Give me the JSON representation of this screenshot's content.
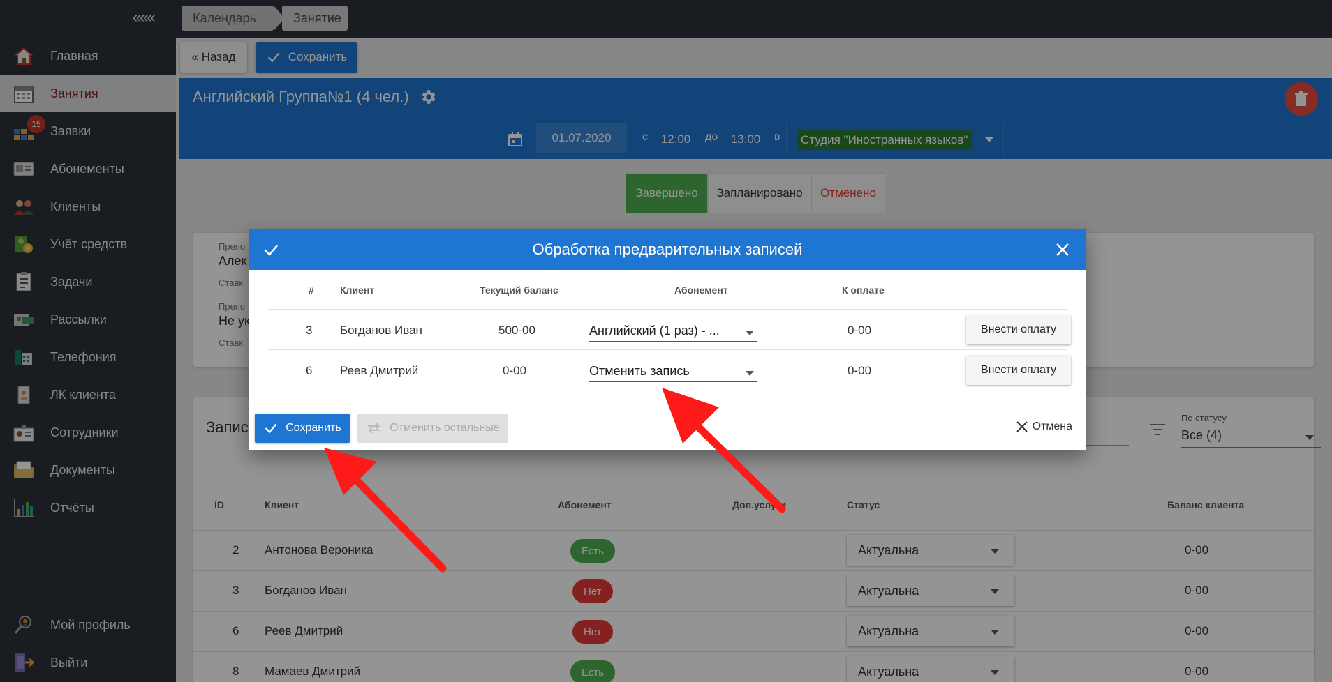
{
  "sidebar": {
    "collapse_label": "«««",
    "items": [
      {
        "label": "Главная",
        "icon": "home-icon"
      },
      {
        "label": "Занятия",
        "icon": "calendar-icon",
        "active": true
      },
      {
        "label": "Заявки",
        "icon": "requests-icon",
        "badge": "15"
      },
      {
        "label": "Абонементы",
        "icon": "subscription-card-icon"
      },
      {
        "label": "Клиенты",
        "icon": "clients-icon"
      },
      {
        "label": "Учёт средств",
        "icon": "money-icon"
      },
      {
        "label": "Задачи",
        "icon": "tasks-icon"
      },
      {
        "label": "Рассылки",
        "icon": "mailing-icon"
      },
      {
        "label": "Телефония",
        "icon": "phone-icon"
      },
      {
        "label": "ЛК клиента",
        "icon": "client-account-icon"
      },
      {
        "label": "Сотрудники",
        "icon": "staff-icon"
      },
      {
        "label": "Документы",
        "icon": "documents-icon"
      },
      {
        "label": "Отчёты",
        "icon": "reports-icon"
      },
      {
        "label": "Мой профиль",
        "icon": "profile-icon"
      },
      {
        "label": "Выйти",
        "icon": "logout-icon"
      }
    ]
  },
  "breadcrumbs": [
    "Календарь",
    "Занятие"
  ],
  "toolbar": {
    "back_label": "« Назад",
    "save_label": "Сохранить"
  },
  "lesson": {
    "title": "Английский Группа№1 (4 чел.)",
    "date": "01.07.2020",
    "from_label": "с",
    "from_time": "12:00",
    "to_label": "до",
    "to_time": "13:00",
    "in_label": "в",
    "room": "Студия \"Иностранных языков\""
  },
  "status_tabs": [
    "Завершено",
    "Запланировано",
    "Отменено"
  ],
  "teacher_card": {
    "label1": "Препо",
    "value1": "Алек",
    "sub1": "Ставк",
    "label2": "Препо",
    "value2": "Не ук",
    "sub2": "Ставк"
  },
  "records": {
    "title": "Запис",
    "status_filter_label": "По статусу",
    "status_filter_value": "Все (4)",
    "columns": [
      "ID",
      "Клиент",
      "Абонемент",
      "Доп.услуги",
      "Статус",
      "Баланс клиента"
    ],
    "rows": [
      {
        "id": "2",
        "client": "Антонова Вероника",
        "subscription": "Есть",
        "has_sub": true,
        "status": "Актуальна",
        "balance": "0-00"
      },
      {
        "id": "3",
        "client": "Богданов Иван",
        "subscription": "Нет",
        "has_sub": false,
        "status": "Актуальна",
        "balance": "0-00"
      },
      {
        "id": "6",
        "client": "Реев Дмитрий",
        "subscription": "Нет",
        "has_sub": false,
        "status": "Актуальна",
        "balance": "0-00"
      },
      {
        "id": "8",
        "client": "Мамаев Дмитрий",
        "subscription": "Есть",
        "has_sub": true,
        "status": "Актуальна",
        "balance": "0-00"
      }
    ]
  },
  "modal": {
    "title": "Обработка предварительных записей",
    "columns": [
      "#",
      "Клиент",
      "Текущий баланс",
      "Абонемент",
      "К оплате"
    ],
    "rows": [
      {
        "num": "3",
        "client": "Богданов Иван",
        "balance": "500-00",
        "subscription": "Английский (1 раз) - ...",
        "to_pay": "0-00",
        "pay_label": "Внести оплату"
      },
      {
        "num": "6",
        "client": "Реев Дмитрий",
        "balance": "0-00",
        "subscription": "Отменить запись",
        "to_pay": "0-00",
        "pay_label": "Внести оплату"
      }
    ],
    "save_label": "Сохранить",
    "cancel_rest_label": "Отменить остальные",
    "cancel_label": "Отмена"
  },
  "colors": {
    "sidebar_bg": "#2b323a",
    "primary": "#1f76d2",
    "success": "#4caf50",
    "danger": "#e53935",
    "annotation_arrow": "#ff1a1a"
  }
}
